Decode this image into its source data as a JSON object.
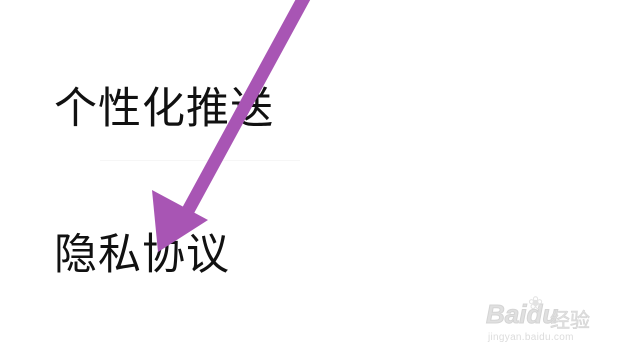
{
  "menu": {
    "items": [
      {
        "label": "个性化推送"
      },
      {
        "label": "隐私协议"
      }
    ]
  },
  "annotation": {
    "arrow_icon": "arrow-down-left-icon",
    "arrow_color": "#a855b4"
  },
  "watermark": {
    "logo": "Baidu",
    "brand": "经验",
    "url": "jingyan.baidu.com"
  }
}
